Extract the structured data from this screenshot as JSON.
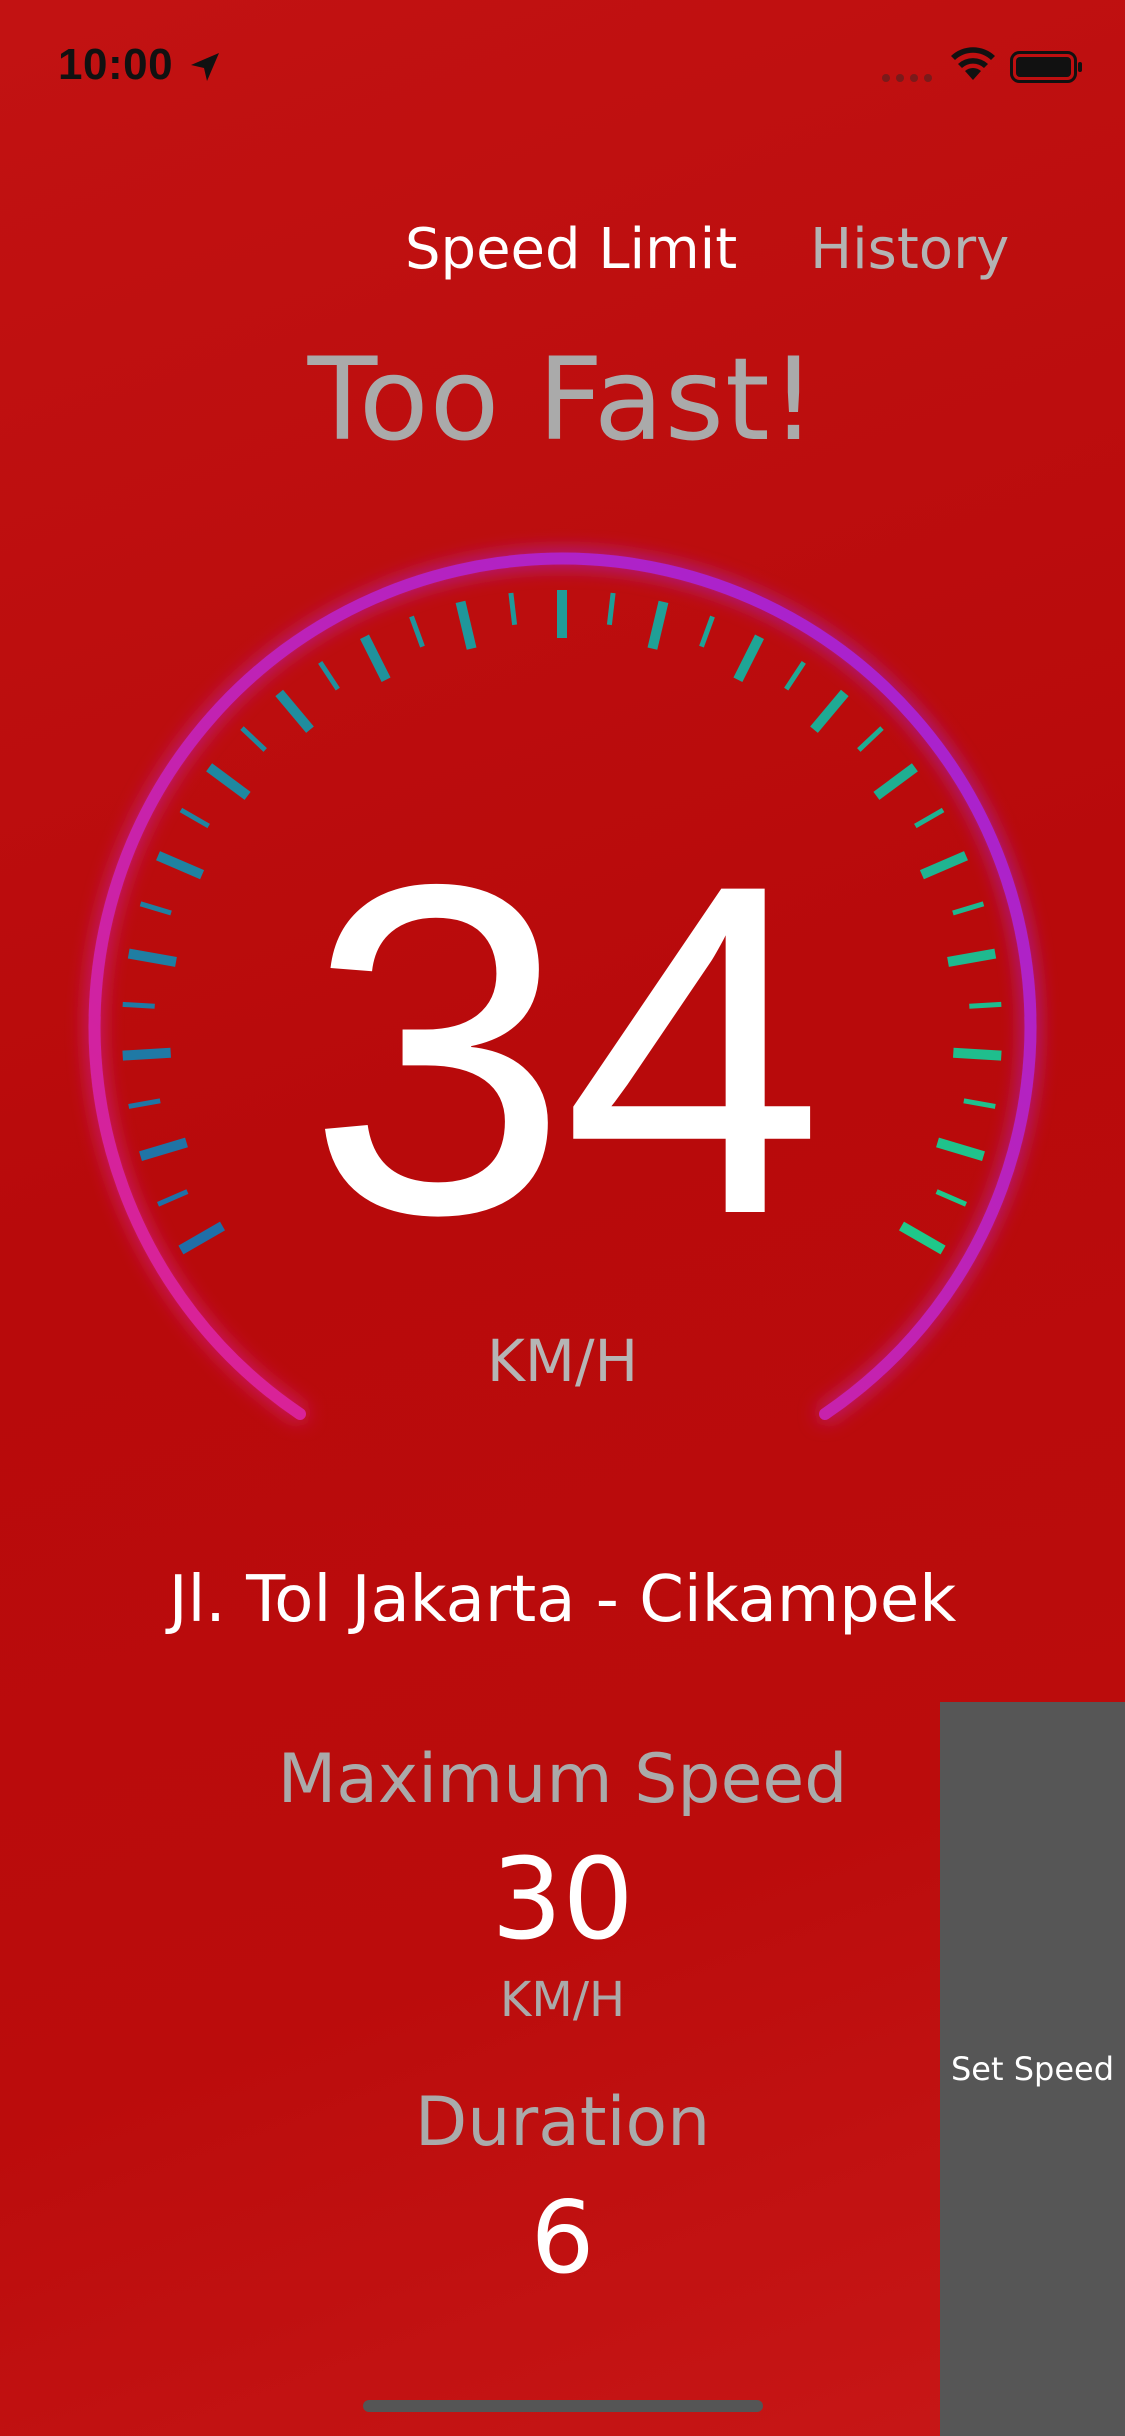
{
  "status_bar": {
    "time": "10:00",
    "location_icon": "location-arrow-icon",
    "signal_icon": "cellular-signal-icon",
    "wifi_icon": "wifi-icon",
    "battery_icon": "battery-icon"
  },
  "tabs": [
    {
      "label": "Speed Limit",
      "selected": true
    },
    {
      "label": "History",
      "selected": false
    }
  ],
  "alert": "Too Fast!",
  "speedometer": {
    "speed": "34",
    "unit": "KM/H",
    "tick_colors": [
      "#1f6fa8",
      "#1fc88a"
    ],
    "ring_colors": [
      "#e02090",
      "#a020d8"
    ]
  },
  "road_name": "Jl. Tol Jakarta - Cikampek",
  "maximum_speed": {
    "label": "Maximum Speed",
    "value": "30",
    "unit": "KM/H"
  },
  "duration": {
    "label": "Duration",
    "value": "6"
  },
  "set_speed_button": "Set Speed",
  "colors": {
    "background": "#bb0c0c",
    "button": "#565656",
    "muted_text": "#aaaaaa"
  }
}
